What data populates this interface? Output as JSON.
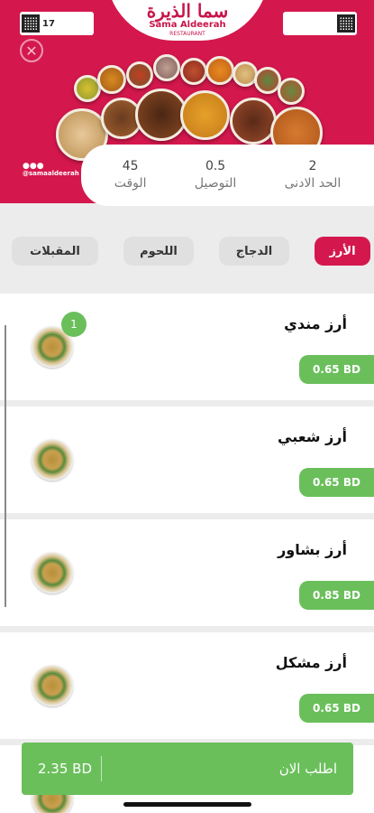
{
  "header": {
    "logo_script": "سما الذيرة",
    "logo_latin": "Sama Aldeerah",
    "logo_sub": "RESTAURANT",
    "qr_left_text": "17",
    "qr_right_text": "",
    "instagram": "@samaaldeerah"
  },
  "info": [
    {
      "value": "2",
      "label": "الحد الادنى"
    },
    {
      "value": "0.5",
      "label": "التوصيل"
    },
    {
      "value": "45",
      "label": "الوقت"
    }
  ],
  "tabs": [
    {
      "label": "الأرز",
      "active": true
    },
    {
      "label": "الدجاج",
      "active": false
    },
    {
      "label": "اللحوم",
      "active": false
    },
    {
      "label": "المقبلات",
      "active": false
    }
  ],
  "items": [
    {
      "title": "أرز مندي",
      "price": "0.65 BD",
      "count": "1"
    },
    {
      "title": "أرز شعبي",
      "price": "0.65 BD"
    },
    {
      "title": "أرز بشاور",
      "price": "0.85 BD"
    },
    {
      "title": "أرز مشكل",
      "price": "0.65 BD"
    }
  ],
  "order": {
    "total": "2.35 BD",
    "label": "اطلب الان"
  },
  "colors": {
    "brand": "#d4184d",
    "accent": "#6abf5b"
  }
}
